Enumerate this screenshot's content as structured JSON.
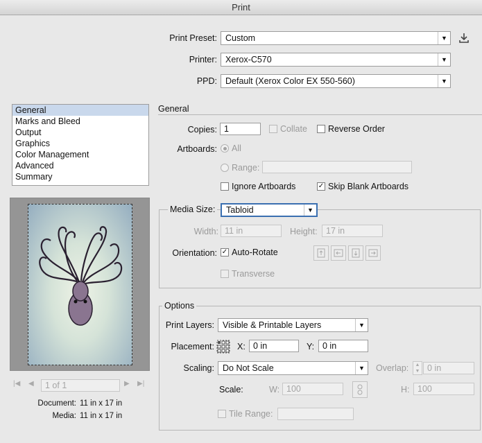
{
  "window": {
    "title": "Print"
  },
  "preset": {
    "label": "Print Preset:",
    "value": "Custom",
    "save_icon": "download-icon"
  },
  "printer": {
    "label": "Printer:",
    "value": "Xerox-C570"
  },
  "ppd": {
    "label": "PPD:",
    "value": "Default (Xerox Color EX 550-560)"
  },
  "categories": [
    "General",
    "Marks and Bleed",
    "Output",
    "Graphics",
    "Color Management",
    "Advanced",
    "Summary"
  ],
  "selected_category": "General",
  "section": {
    "title": "General"
  },
  "copies": {
    "label": "Copies:",
    "value": "1",
    "collate": "Collate",
    "reverse": "Reverse Order"
  },
  "artboards": {
    "label": "Artboards:",
    "all": "All",
    "range": "Range:",
    "range_value": "",
    "ignore": "Ignore Artboards",
    "skip": "Skip Blank Artboards"
  },
  "media": {
    "label": "Media Size:",
    "value": "Tabloid",
    "width_label": "Width:",
    "width": "11 in",
    "height_label": "Height:",
    "height": "17 in",
    "orientation_label": "Orientation:",
    "auto_rotate": "Auto-Rotate",
    "transverse": "Transverse"
  },
  "options": {
    "title": "Options",
    "layers_label": "Print Layers:",
    "layers": "Visible & Printable Layers",
    "placement_label": "Placement:",
    "x_label": "X:",
    "x": "0 in",
    "y_label": "Y:",
    "y": "0 in",
    "scaling_label": "Scaling:",
    "scaling": "Do Not Scale",
    "overlap_label": "Overlap:",
    "overlap": "0 in",
    "scale_label": "Scale:",
    "w_label": "W:",
    "w": "100",
    "h_label": "H:",
    "h": "100",
    "tile_label": "Tile Range:",
    "tile_value": ""
  },
  "preview": {
    "page_indicator": "1 of 1",
    "document_label": "Document:",
    "document": "11 in x 17 in",
    "media_label": "Media:",
    "media": "11 in x 17 in"
  },
  "colors": {
    "selection": "#c9d8ec",
    "preview_bg": "#959595",
    "octopus": "#8a7590"
  }
}
